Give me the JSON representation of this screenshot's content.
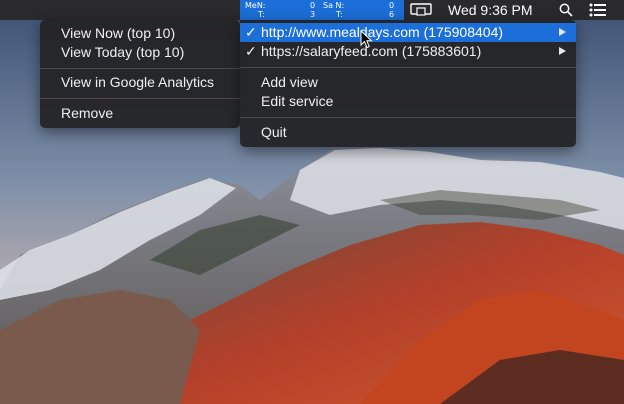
{
  "menubar": {
    "analytics": {
      "m1_label": "MeN:",
      "m1_value": "0",
      "t1_label": "T:",
      "t1_value": "3",
      "m2_label": "Sa N:",
      "m2_value": "0",
      "t2_label": "T:",
      "t2_value": "6"
    },
    "clock": "Wed 9:36 PM",
    "icons": [
      "display-mirror-icon",
      "spotlight-search-icon",
      "notification-center-icon"
    ]
  },
  "left_menu": {
    "items": [
      {
        "label": "View Now (top 10)"
      },
      {
        "label": "View Today (top 10)"
      },
      {
        "label": "View in Google Analytics"
      },
      {
        "label": "Remove"
      }
    ]
  },
  "right_menu": {
    "sites": [
      {
        "check": "✓",
        "label": "http://www.mealdays.com (175908404)",
        "highlighted": true
      },
      {
        "check": "✓",
        "label": "https://salaryfeed.com (175883601)",
        "highlighted": false
      }
    ],
    "actions": [
      {
        "label": "Add view"
      },
      {
        "label": "Edit service"
      }
    ],
    "quit": "Quit"
  },
  "colors": {
    "highlight": "#1c6fd8",
    "menu_bg": "#242426",
    "menubar_bg": "#2a2a2c"
  }
}
